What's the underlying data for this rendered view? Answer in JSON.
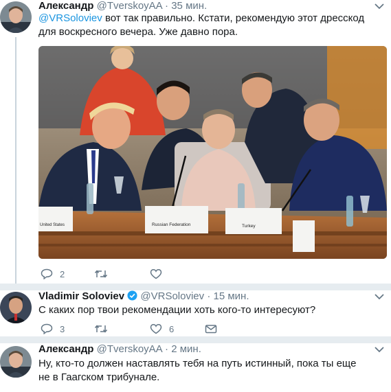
{
  "tweets": [
    {
      "author": "Александр",
      "handle": "@TverskoyAA",
      "dot": "·",
      "time": "35 мин.",
      "mention": "@VRSoloviev",
      "text": "вот так правильно. Кстати, рекомендую этот дресскод для воскресного вечера. Уже давно пора.",
      "photo_labels": [
        "United States",
        "Russian Federation",
        "Turkey"
      ],
      "replies": "2",
      "retweets": "",
      "likes": ""
    },
    {
      "author": "Vladimir Soloviev",
      "handle": "@VRSoloviev",
      "dot": "·",
      "time": "15 мин.",
      "text": "С каких пор твои рекомендации хоть кого-то интересуют?",
      "replies": "3",
      "retweets": "",
      "likes": "6"
    },
    {
      "author": "Александр",
      "handle": "@TverskoyAA",
      "dot": "·",
      "time": "2 мин.",
      "text": "Ну, кто-то должен наставлять тебя на путь истинный, пока ты еще не в Гаагском трибунале."
    }
  ],
  "colors": {
    "link": "#1b95e0",
    "muted": "#657786",
    "verified": "#1da1f2",
    "separator": "#e6ecf0"
  },
  "icons": [
    "reply-icon",
    "retweet-icon",
    "like-icon",
    "dm-icon",
    "chevron-down-icon",
    "verified-badge-icon"
  ]
}
